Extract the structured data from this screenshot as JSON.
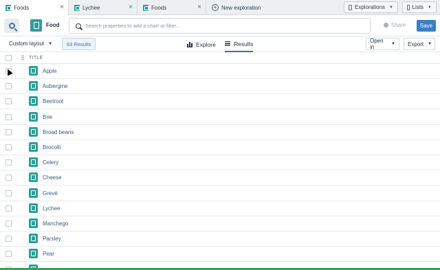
{
  "tabs": [
    {
      "label": "Foods",
      "active": true,
      "closable": true
    },
    {
      "label": "Lychee",
      "active": false,
      "closable": true
    },
    {
      "label": "Foods",
      "active": false,
      "closable": true
    },
    {
      "label": "New exploration",
      "active": false,
      "closable": false
    }
  ],
  "topbar": {
    "explorations_label": "Explorations",
    "lists_label": "Lists"
  },
  "search": {
    "object_label": "Food",
    "placeholder": "Search properties to add a chart or filter...",
    "share_label": "Share",
    "save_label": "Save"
  },
  "toolbar": {
    "layout_label": "Custom layout",
    "results_count": "63 Results",
    "explore_label": "Explore",
    "results_label": "Results",
    "open_in_label": "Open in",
    "export_label": "Export"
  },
  "table": {
    "column_header": "TITLE",
    "rows": [
      "Apple",
      "Aubergine",
      "Beetroot",
      "Brie",
      "Broad beans",
      "Brocolli",
      "Celery",
      "Cheese",
      "Grevé",
      "Lychee",
      "Manchego",
      "Parsley",
      "Pear",
      ""
    ]
  },
  "colors": {
    "accent": "#3b7fc4",
    "object_icon": "#2aa198",
    "link_text": "#3a5a80"
  }
}
